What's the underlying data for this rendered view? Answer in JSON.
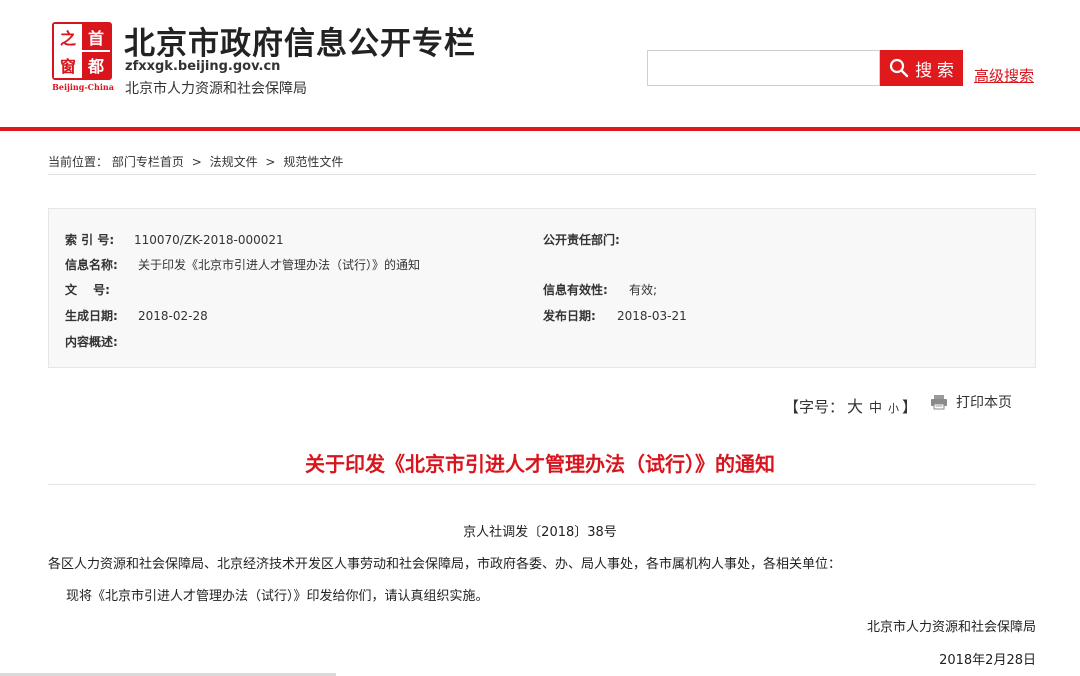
{
  "header": {
    "logo": {
      "chars": [
        "之",
        "首",
        "窗",
        "都"
      ],
      "subtitle": "Beijing-China"
    },
    "site_title": "北京市政府信息公开专栏",
    "domain": "zfxxgk.beijing.gov.cn",
    "org": "北京市人力资源和社会保障局",
    "search": {
      "value": "",
      "placeholder": "",
      "button_label": "搜 索",
      "advanced_label": "高级搜索"
    }
  },
  "breadcrumb": {
    "prefix": "当前位置：",
    "items": [
      "部门专栏首页",
      "法规文件",
      "规范性文件"
    ],
    "separator": ">"
  },
  "meta": {
    "index_no": {
      "label": "索 引 号:",
      "value": "110070/ZK-2018-000021"
    },
    "info_name": {
      "label": "信息名称:",
      "value": "关于印发《北京市引进人才管理办法（试行）》的通知"
    },
    "doc_no": {
      "label": "文　 号:",
      "value": ""
    },
    "created": {
      "label": "生成日期:",
      "value": "2018-02-28"
    },
    "summary": {
      "label": "内容概述:",
      "value": ""
    },
    "dept": {
      "label": "公开责任部门:",
      "value": ""
    },
    "validity": {
      "label": "信息有效性:",
      "value": "有效;"
    },
    "published": {
      "label": "发布日期:",
      "value": "2018-03-21"
    }
  },
  "tools": {
    "font_prefix": "【字号：",
    "font_large": "大",
    "font_medium": "中",
    "font_small": "小",
    "font_suffix": "】",
    "print_label": "打印本页"
  },
  "article": {
    "title": "关于印发《北京市引进人才管理办法（试行）》的通知",
    "doc_number": "京人社调发〔2018〕38号",
    "para1": "各区人力资源和社会保障局、北京经济技术开发区人事劳动和社会保障局，市政府各委、办、局人事处，各市属机构人事处，各相关单位：",
    "para2": "现将《北京市引进人才管理办法（试行）》印发给你们，请认真组织实施。",
    "signature": "北京市人力资源和社会保障局",
    "date": "2018年2月28日"
  },
  "colors": {
    "brand_red": "#e0191d",
    "title_red": "#d8141c"
  }
}
